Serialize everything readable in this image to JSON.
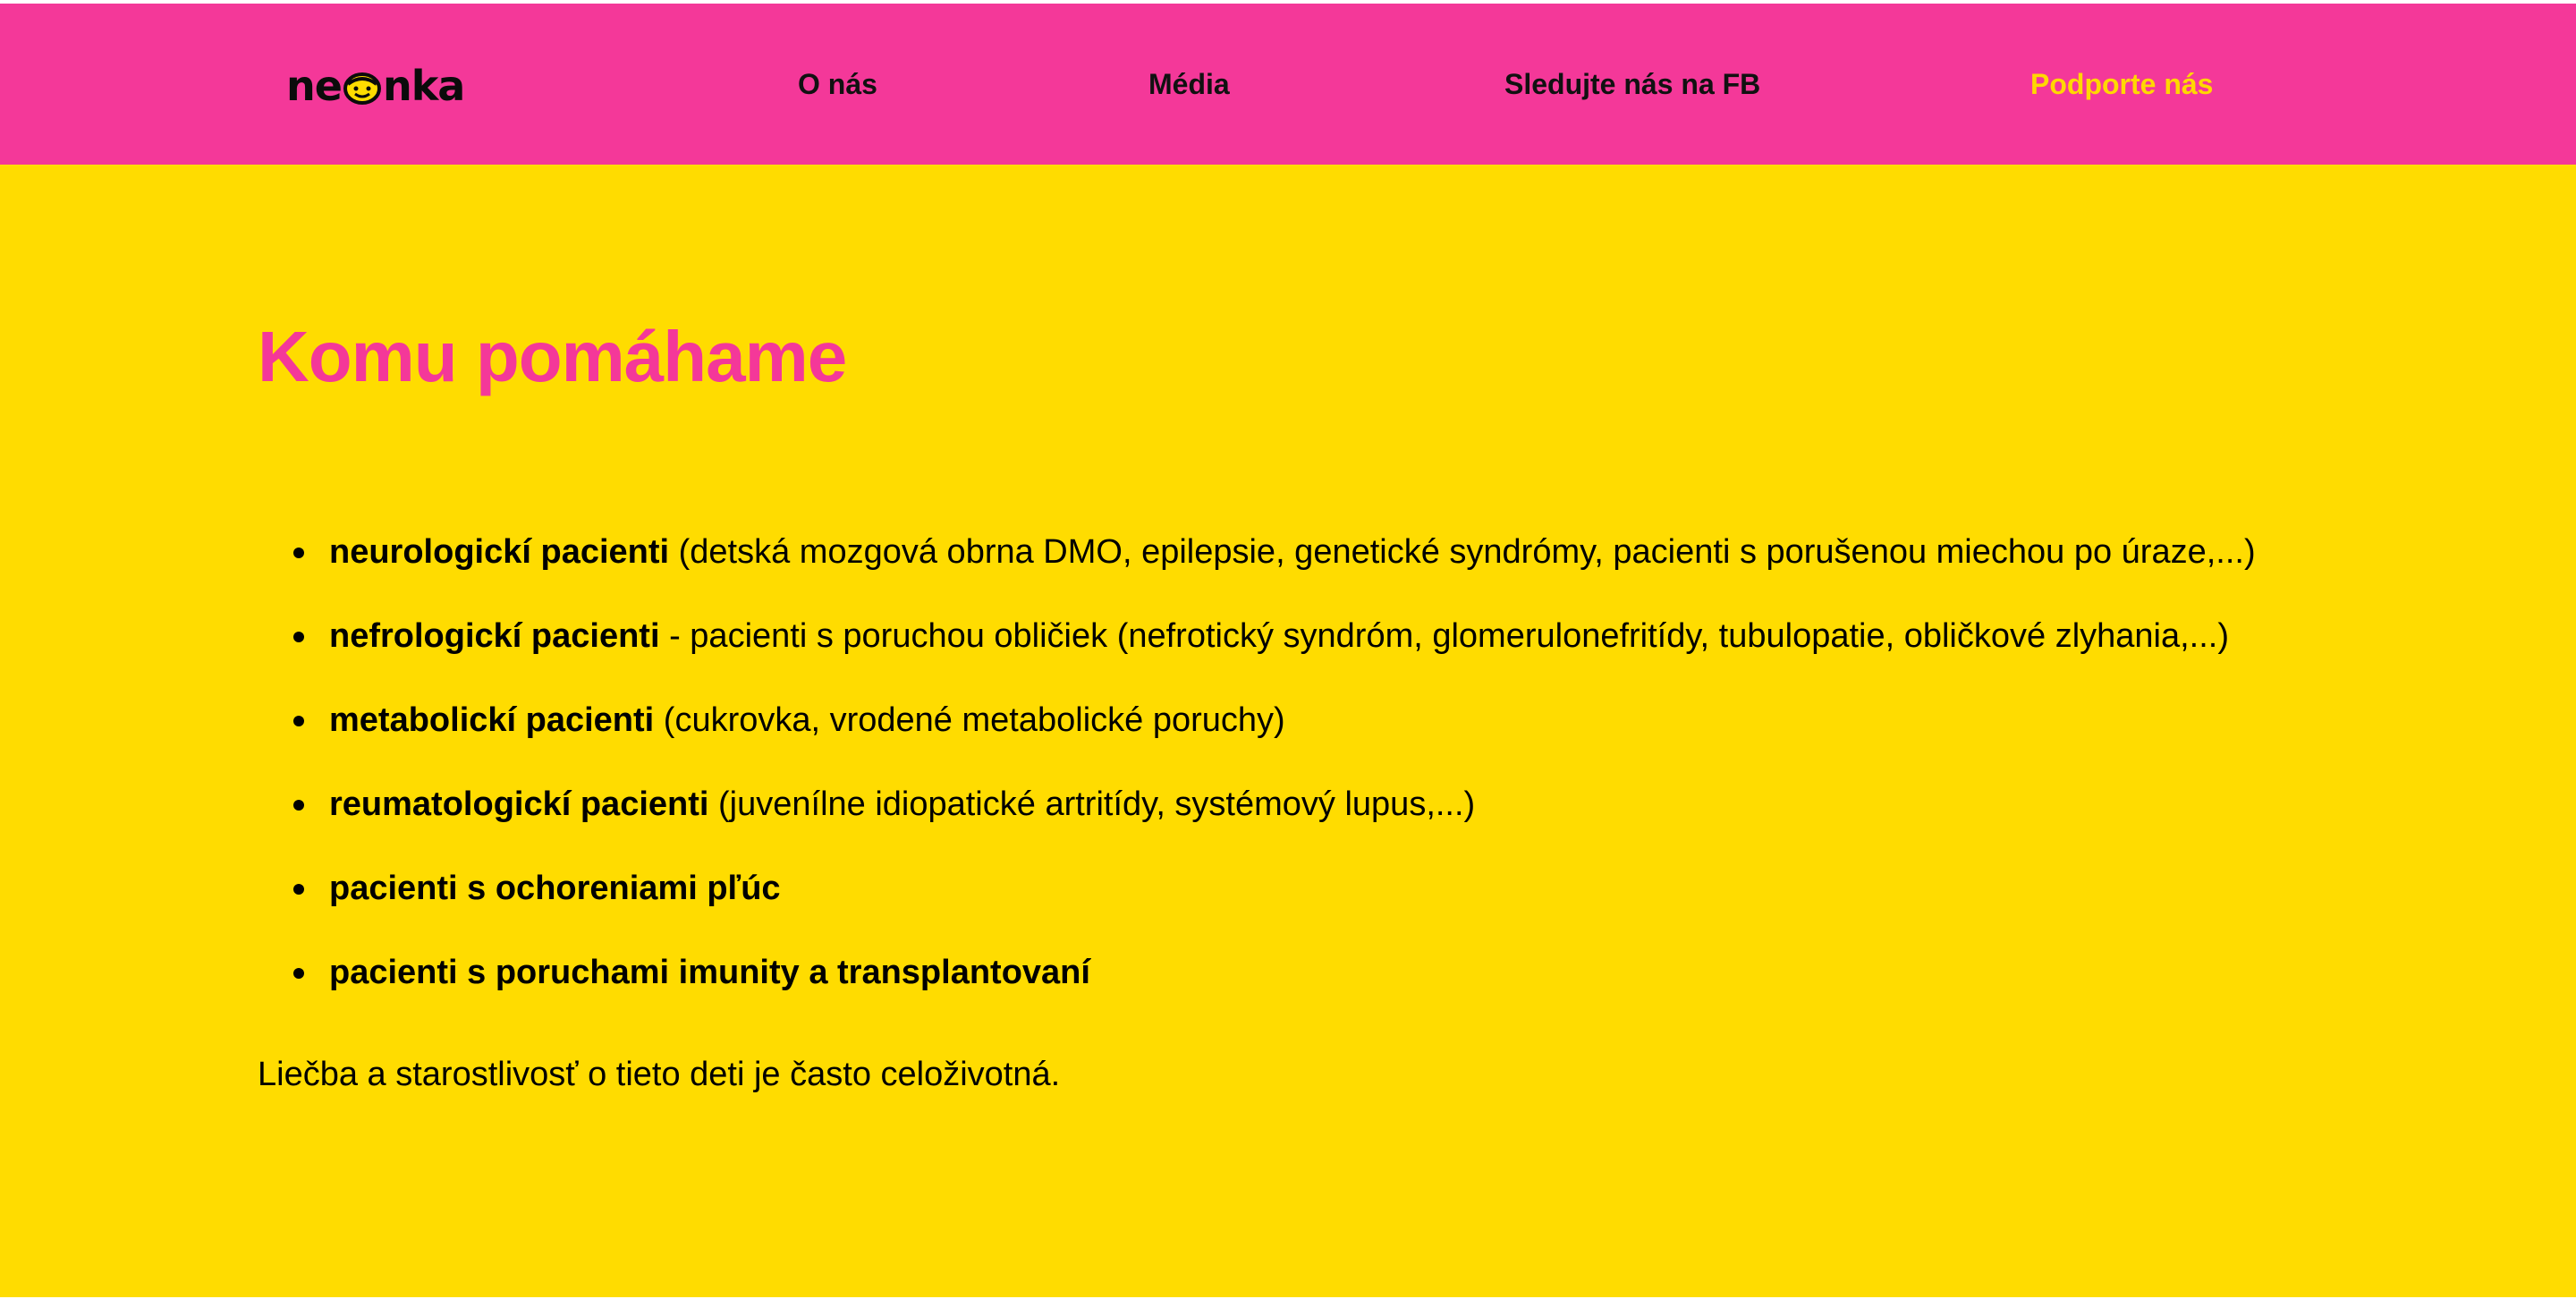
{
  "header": {
    "logo": {
      "left": "ne",
      "right": "nka",
      "icon": "smiling-face-icon"
    },
    "nav": [
      {
        "label": "O nás"
      },
      {
        "label": "Média"
      },
      {
        "label": "Sledujte nás na FB"
      },
      {
        "label": "Podporte nás"
      }
    ]
  },
  "main": {
    "title": "Komu pomáhame",
    "items": [
      {
        "bold": "neurologickí pacienti",
        "rest": " (detská mozgová obrna DMO, epilepsie, genetické syndrómy, pacienti s porušenou miechou po úraze,...)"
      },
      {
        "bold": "nefrologickí pacienti",
        "rest": " - pacienti s poruchou obličiek (nefrotický syndróm, glomerulonefritídy, tubulopatie, obličkové zlyhania,...)"
      },
      {
        "bold": "metabolickí pacienti",
        "rest": " (cukrovka, vrodené metabolické poruchy)"
      },
      {
        "bold": "reumatologickí pacienti",
        "rest": " (juvenílne idiopatické artritídy, systémový lupus,...)"
      },
      {
        "bold": "pacienti s ochoreniami pľúc",
        "rest": ""
      },
      {
        "bold": "pacienti s poruchami imunity a transplantovaní",
        "rest": ""
      }
    ],
    "note": "Liečba a starostlivosť o tieto deti je často celoživotná."
  },
  "colors": {
    "header_bg": "#f43899",
    "main_bg": "#ffdc00",
    "title": "#f43899",
    "nav_highlight": "#ffd800"
  }
}
